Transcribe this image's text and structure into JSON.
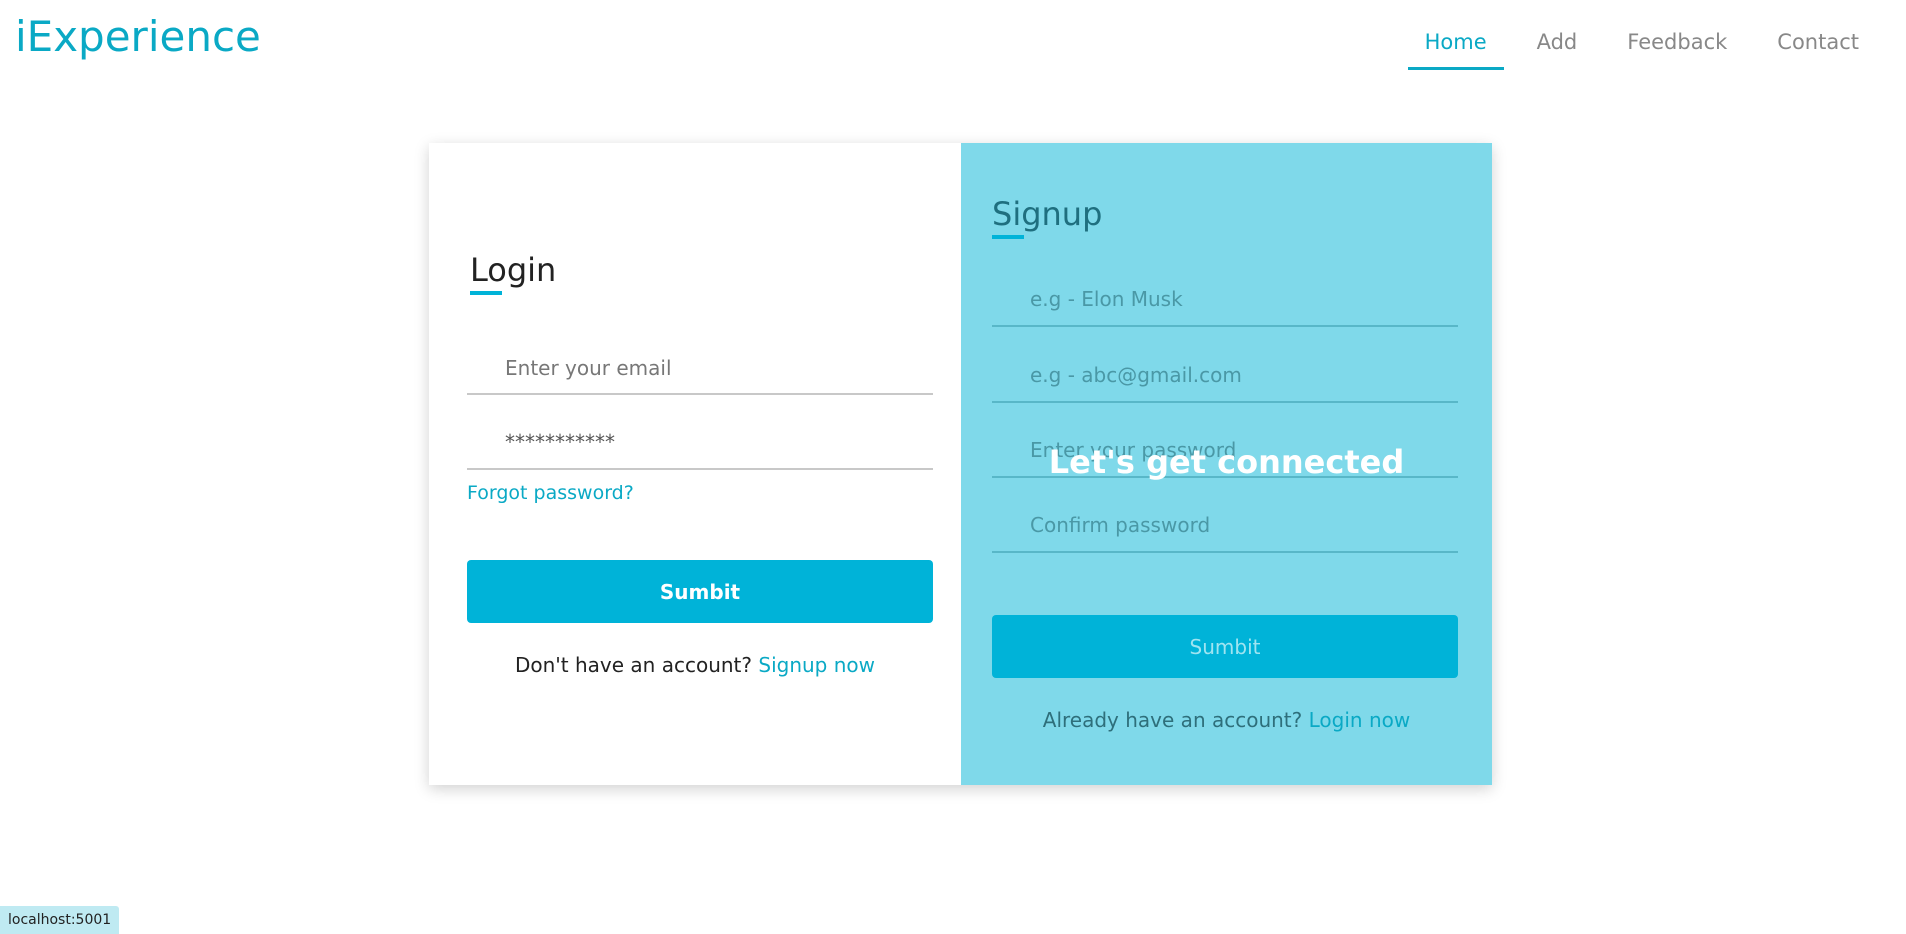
{
  "app": {
    "logo": "iExperience"
  },
  "nav": {
    "items": [
      {
        "label": "Home",
        "active": true
      },
      {
        "label": "Add",
        "active": false
      },
      {
        "label": "Feedback",
        "active": false
      },
      {
        "label": "Contact",
        "active": false
      }
    ]
  },
  "login": {
    "title": "Login",
    "email_placeholder": "Enter your email",
    "password_value": "***********",
    "forgot_label": "Forgot password?",
    "submit_label": "Sumbit",
    "switch_text": "Don't have an account?",
    "switch_link": "Signup now"
  },
  "signup": {
    "title": "Signup",
    "name_placeholder": "e.g - Elon Musk",
    "email_placeholder": "e.g - abc@gmail.com",
    "password_placeholder": "Enter your password",
    "confirm_placeholder": "Confirm password",
    "submit_label": "Sumbit",
    "switch_text": "Already have an account?",
    "switch_link": "Login now"
  },
  "overlay": {
    "heading": "Let's get connected"
  },
  "status": {
    "url": "localhost:5001"
  },
  "colors": {
    "accent": "#00b3d8",
    "signup_panel": "#7fd9ea"
  }
}
